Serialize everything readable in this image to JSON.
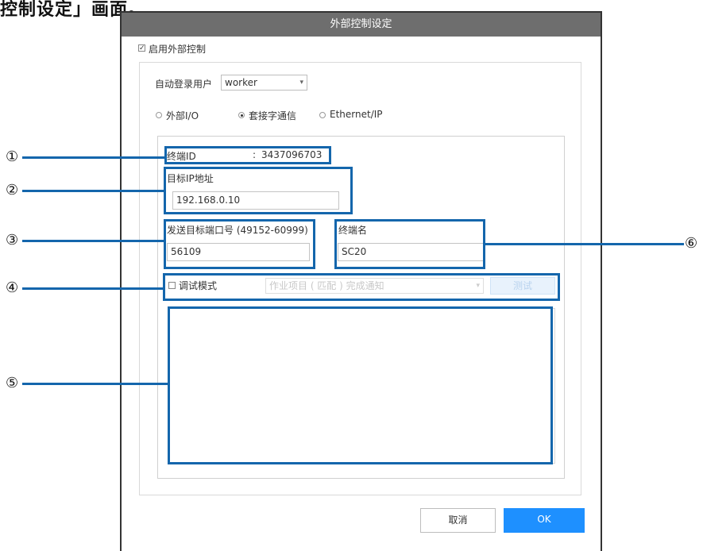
{
  "caption": "控制设定」画面。",
  "dialog": {
    "title": "外部控制设定",
    "enable_label": "启用外部控制",
    "enable_checked_glyph": "✓",
    "auto_login_label": "自动登录用户",
    "auto_login_value": "worker",
    "radios": [
      {
        "label": "外部I/O",
        "selected": false
      },
      {
        "label": "套接字通信",
        "selected": true
      },
      {
        "label": "Ethernet/IP",
        "selected": false
      }
    ],
    "terminal_id_label": "终端ID",
    "terminal_id_sep": ":",
    "terminal_id_value": "3437096703",
    "target_ip_label": "目标IP地址",
    "target_ip_value": "192.168.0.10",
    "target_port_label": "发送目标端口号 (49152-60999)",
    "target_port_value": "56109",
    "terminal_name_label": "终端名",
    "terminal_name_value": "SC20",
    "debug_label": "调试模式",
    "debug_select_value": "作业项目 ( 匹配 ) 完成通知",
    "test_button": "测试",
    "cancel_button": "取消",
    "ok_button": "OK"
  },
  "markers": [
    "①",
    "②",
    "③",
    "④",
    "⑤",
    "⑥"
  ],
  "colors": {
    "callout": "#1466ac",
    "titlebar": "#6e6e6e",
    "ok": "#1e90ff"
  }
}
